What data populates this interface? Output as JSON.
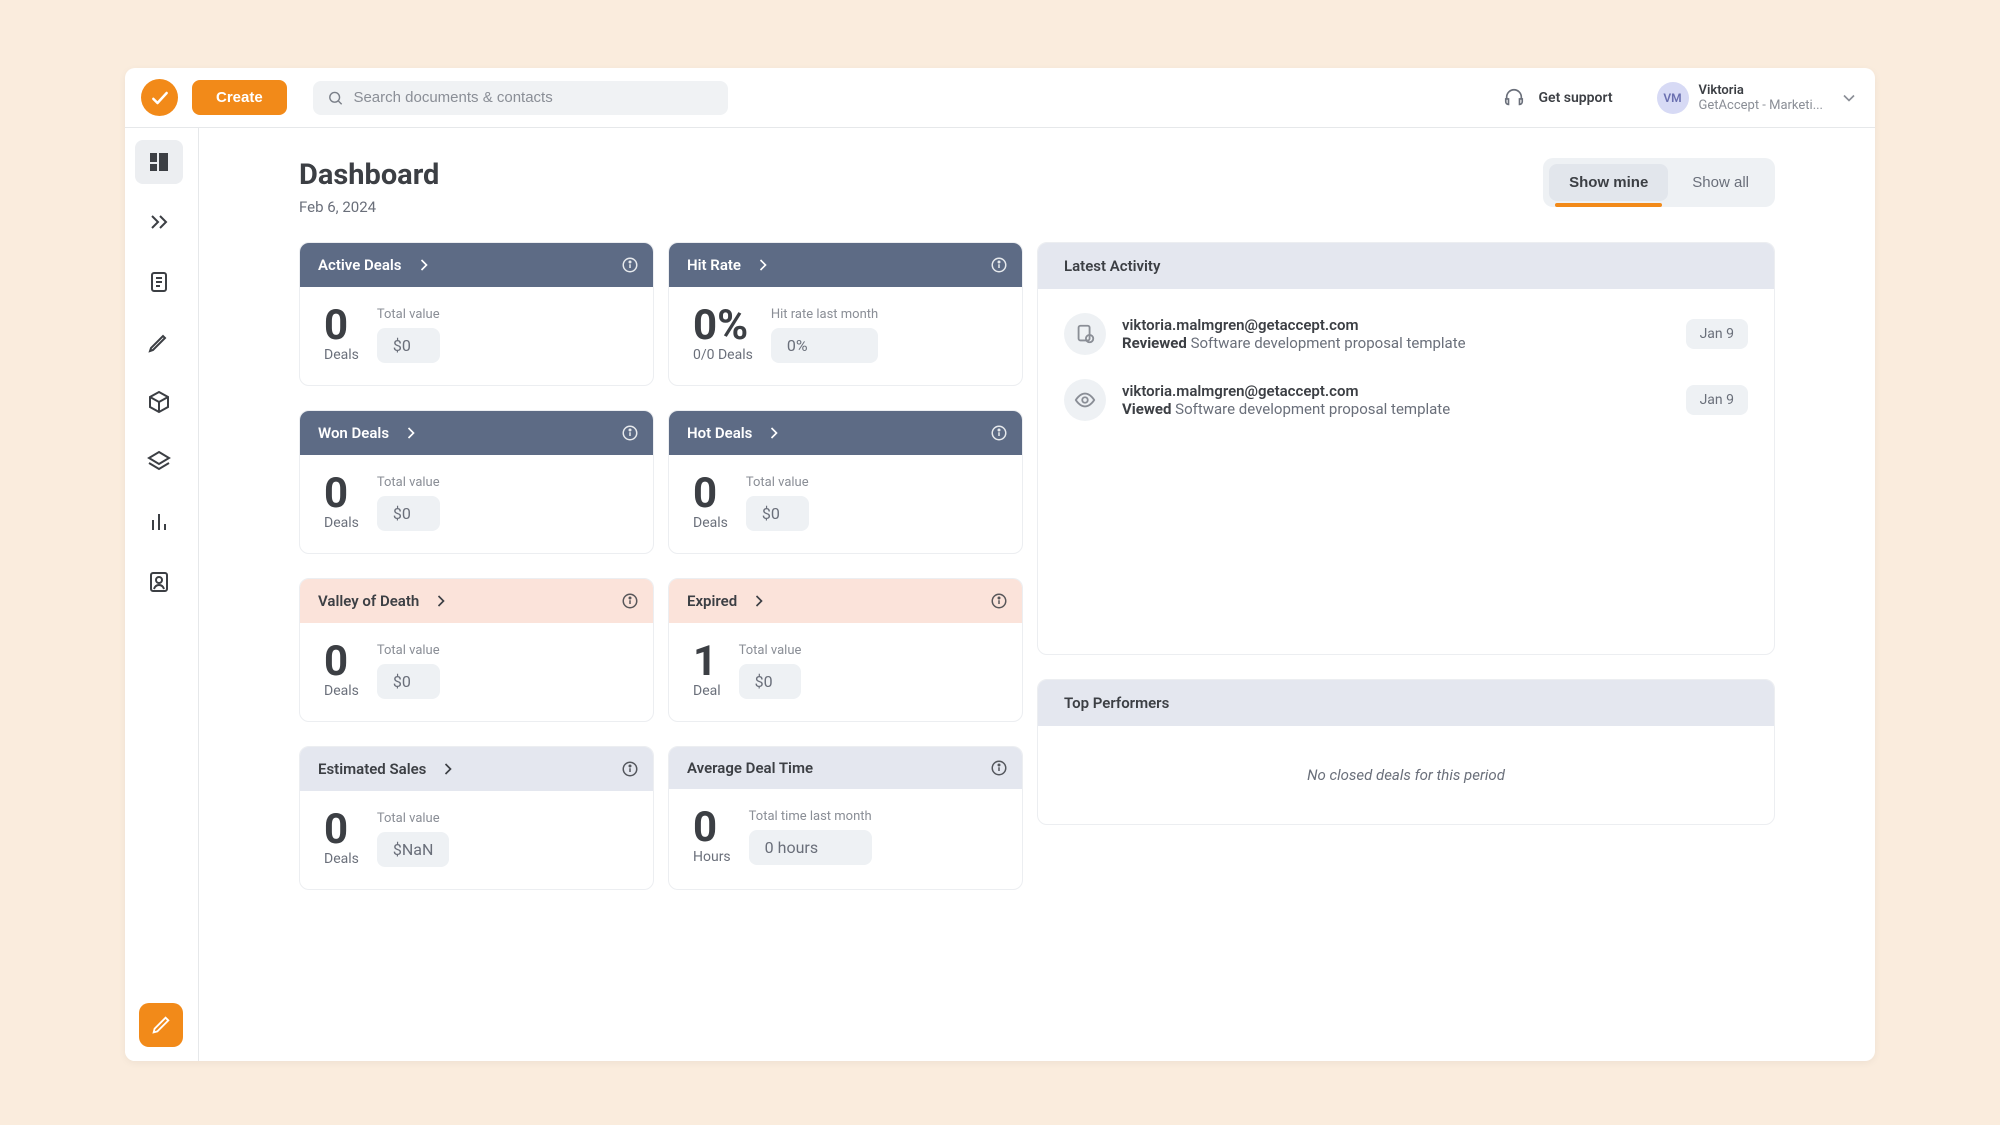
{
  "topbar": {
    "create_label": "Create",
    "search_placeholder": "Search documents & contacts",
    "support_label": "Get support",
    "user": {
      "initials": "VM",
      "name": "Viktoria",
      "org": "GetAccept - Marketi..."
    }
  },
  "page": {
    "title": "Dashboard",
    "date": "Feb 6, 2024"
  },
  "toggle": {
    "show_mine": "Show mine",
    "show_all": "Show all"
  },
  "cards": {
    "active_deals": {
      "title": "Active Deals",
      "count": "0",
      "unit": "Deals",
      "mini_label": "Total value",
      "mini_value": "$0"
    },
    "hit_rate": {
      "title": "Hit Rate",
      "count": "0%",
      "unit": "0/0 Deals",
      "mini_label": "Hit rate last month",
      "mini_value": "0%"
    },
    "won_deals": {
      "title": "Won Deals",
      "count": "0",
      "unit": "Deals",
      "mini_label": "Total value",
      "mini_value": "$0"
    },
    "hot_deals": {
      "title": "Hot Deals",
      "count": "0",
      "unit": "Deals",
      "mini_label": "Total value",
      "mini_value": "$0"
    },
    "valley": {
      "title": "Valley of Death",
      "count": "0",
      "unit": "Deals",
      "mini_label": "Total value",
      "mini_value": "$0"
    },
    "expired": {
      "title": "Expired",
      "count": "1",
      "unit": "Deal",
      "mini_label": "Total value",
      "mini_value": "$0"
    },
    "estimated": {
      "title": "Estimated Sales",
      "count": "0",
      "unit": "Deals",
      "mini_label": "Total value",
      "mini_value": "$NaN"
    },
    "avg_deal_time": {
      "title": "Average Deal Time",
      "count": "0",
      "unit": "Hours",
      "mini_label": "Total time last month",
      "mini_value": "0 hours"
    }
  },
  "latest_activity": {
    "title": "Latest Activity",
    "items": [
      {
        "email": "viktoria.malmgren@getaccept.com",
        "action": "Reviewed",
        "doc": "Software development proposal template",
        "date": "Jan 9"
      },
      {
        "email": "viktoria.malmgren@getaccept.com",
        "action": "Viewed",
        "doc": "Software development proposal template",
        "date": "Jan 9"
      }
    ]
  },
  "top_performers": {
    "title": "Top Performers",
    "empty": "No closed deals for this period"
  }
}
